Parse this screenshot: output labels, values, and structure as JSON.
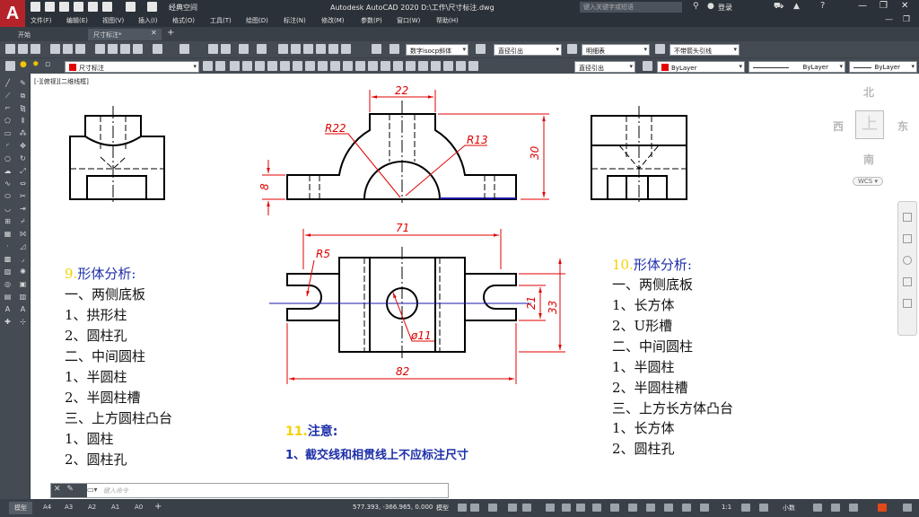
{
  "app": {
    "logo": "A",
    "workspace": "经典空间",
    "title": "Autodesk AutoCAD 2020    D:\\工作\\尺寸标注.dwg",
    "search_placeholder": "键入关键字或短语",
    "login": "登录"
  },
  "menu": [
    "文件(F)",
    "编辑(E)",
    "视图(V)",
    "插入(I)",
    "格式(O)",
    "工具(T)",
    "绘图(D)",
    "标注(N)",
    "修改(M)",
    "参数(P)",
    "窗口(W)",
    "帮助(H)"
  ],
  "file_tabs": [
    "开始",
    "尺寸标注*"
  ],
  "toolbar1": {
    "text_style": "数字isocp斜体",
    "dim_style": "直径引出",
    "table_style": "明细表",
    "mleader_style": "不带箭头引线"
  },
  "toolbar2": {
    "layer": "尺寸标注",
    "dim_style2": "直径引出",
    "color": "ByLayer",
    "linetype": "ByLayer",
    "lineweight": "ByLayer"
  },
  "view_label": "[-][俯视][二维线框]",
  "viewcube": {
    "north": "北",
    "south": "南",
    "east": "东",
    "west": "西",
    "top": "上",
    "wcs": "WCS"
  },
  "drawing_dims": {
    "d22": "22",
    "r22": "R22",
    "r13": "R13",
    "d30": "30",
    "d8": "8",
    "d71": "71",
    "r5": "R5",
    "d21": "21",
    "d33": "33",
    "phi11": "ø11",
    "d82": "82"
  },
  "note9": {
    "num": "9.",
    "title": "形体分析:",
    "lines": [
      "一、两侧底板",
      "1、拱形柱",
      "2、圆柱孔",
      "二、中间圆柱",
      "1、半圆柱",
      "2、半圆柱槽",
      "三、上方圆柱凸台",
      "1、圆柱",
      "2、圆柱孔"
    ]
  },
  "note10": {
    "num": "10.",
    "title": "形体分析:",
    "lines": [
      "一、两侧底板",
      "1、长方体",
      "2、U形槽",
      "二、中间圆柱",
      "1、半圆柱",
      "2、半圆柱槽",
      "三、上方长方体凸台",
      "1、长方体",
      "2、圆柱孔"
    ]
  },
  "note11": {
    "num": "11.",
    "title": "注意:",
    "line": "1、截交线和相贯线上不应标注尺寸"
  },
  "command": {
    "placeholder": "键入命令"
  },
  "layout_tabs": [
    "模型",
    "A4",
    "A3",
    "A2",
    "A1",
    "A0"
  ],
  "status": {
    "coords": "577.393, -366.965, 0.000",
    "mode": "模型",
    "scale": "1:1",
    "units": "小数"
  }
}
